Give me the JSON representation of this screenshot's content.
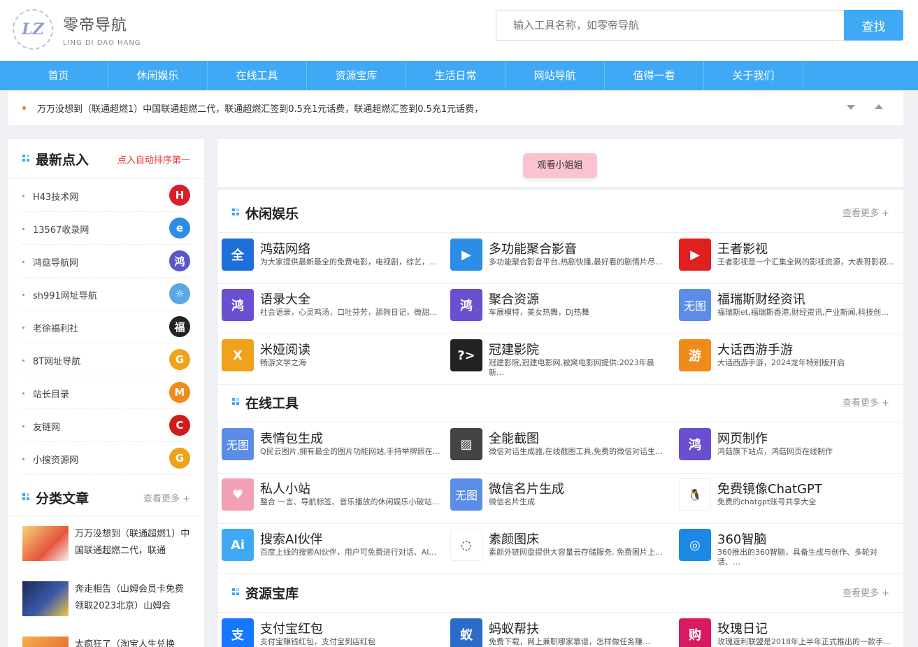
{
  "brand": {
    "name_cn": "零帝导航",
    "name_en": "LING DI DAO HANG",
    "mark": "LZ"
  },
  "search": {
    "placeholder": "输入工具名称，如零帝导航",
    "button": "查找"
  },
  "nav": [
    "首页",
    "休闲娱乐",
    "在线工具",
    "资源宝库",
    "生活日常",
    "网站导航",
    "值得一看",
    "关于我们"
  ],
  "ticker": {
    "text": "万万没想到（联通超燃1）中国联通超燃二代，联通超燃汇签到0.5充1元话费，联通超燃汇签到0.5充1元话费，"
  },
  "colors": {
    "accent": "#3fa9f5",
    "highlight": "#e23b3b",
    "dot": "#f57a18"
  },
  "sidebar": {
    "latest": {
      "title": "最新点入",
      "subtitle": "点入自动排序第一",
      "items": [
        {
          "name": "H43技术网",
          "icon": "H",
          "color": "#d8202a"
        },
        {
          "name": "13567收录网",
          "icon": "e",
          "color": "#2b8de6"
        },
        {
          "name": "鸿菇导航网",
          "icon": "鸿",
          "color": "#5a56c9"
        },
        {
          "name": "sh991网址导航",
          "icon": "☼",
          "color": "#5aa7e6"
        },
        {
          "name": "老徐福利社",
          "icon": "福",
          "color": "#222222"
        },
        {
          "name": "8T网址导航",
          "icon": "G",
          "color": "#f0a21b"
        },
        {
          "name": "站长目录",
          "icon": "M",
          "color": "#f08a1b"
        },
        {
          "name": "友链网",
          "icon": "C",
          "color": "#d21b1b"
        },
        {
          "name": "小搜资源网",
          "icon": "G",
          "color": "#f0a21b"
        }
      ]
    },
    "articles": {
      "title": "分类文章",
      "more": "查看更多 +",
      "items": [
        {
          "title": "万万没想到（联通超燃1）中国联通超燃二代，联通"
        },
        {
          "title": "奔走相告（山姆会员卡免费领取2023北京）山姆会"
        },
        {
          "title": "太疯狂了（淘宝人生兑换"
        }
      ]
    }
  },
  "main": {
    "banner_button": "观看小姐姐",
    "more_label": "查看更多 +",
    "categories": [
      {
        "title": "休闲娱乐",
        "sites": [
          {
            "name": "鸿菇网络",
            "desc": "为大家提供最新最全的免费电影，电视剧，综艺，…",
            "icon": "全",
            "color": "#1e6fd9"
          },
          {
            "name": "多功能聚合影音",
            "desc": "多功能聚合影音平台,热剧快播,最好看的剧情片尽…",
            "icon": "▶",
            "color": "#2b8de6"
          },
          {
            "name": "王者影视",
            "desc": "王者影视是一个汇集全网的影视资源，大表哥影视…",
            "icon": "▶",
            "color": "#e02020"
          },
          {
            "name": "语录大全",
            "desc": "社会语录，心灵鸡汤，口吐芬芳，舔狗日记，微甜…",
            "icon": "鸿",
            "color": "#6a4fd1"
          },
          {
            "name": "聚合资源",
            "desc": "车展模特，美女热舞，DJ热舞",
            "icon": "鸿",
            "color": "#6a4fd1"
          },
          {
            "name": "福瑞斯财经资讯",
            "desc": "福瑞斯et,福瑞斯香港,财经资讯,产业新闻,科技创…",
            "icon": "无图",
            "color": "#5b8de8"
          },
          {
            "name": "米娅阅读",
            "desc": "畅游文学之海",
            "icon": "X",
            "color": "#f0a21b"
          },
          {
            "name": "冠建影院",
            "desc": "冠建影院,冠建电影网,被窝电影网提供:2023年最新…",
            "icon": "?>",
            "color": "#222222"
          },
          {
            "name": "大话西游手游",
            "desc": "大话西游手游，2024龙年特别版开启",
            "icon": "游",
            "color": "#f08a1b"
          }
        ]
      },
      {
        "title": "在线工具",
        "sites": [
          {
            "name": "表情包生成",
            "desc": "Q民云图片,拥有最全的图片功能网站,手持举牌照在…",
            "icon": "无图",
            "color": "#5b8de8"
          },
          {
            "name": "全能截图",
            "desc": "微信对话生成器,在线截图工具,免费的微信对话生…",
            "icon": "▨",
            "color": "#444444"
          },
          {
            "name": "网页制作",
            "desc": "鸿菇旗下站点，鸿菇网页在线制作",
            "icon": "鸿",
            "color": "#6a4fd1"
          },
          {
            "name": "私人小站",
            "desc": "整合 一言、导航标签、音乐播放的休闲娱乐小破站…",
            "icon": "♥",
            "color": "#f2a0b3"
          },
          {
            "name": "微信名片生成",
            "desc": "微信名片生成",
            "icon": "无图",
            "color": "#5b8de8"
          },
          {
            "name": "免费镜像ChatGPT",
            "desc": "免费的chatgpt账号共享大全",
            "icon": "🐧",
            "color": "#ffffff"
          },
          {
            "name": "搜索AI伙伴",
            "desc": "百度上线的搜索AI伙伴，用户可免费进行对话、AI…",
            "icon": "Ai",
            "color": "#3fa9f5"
          },
          {
            "name": "素颜图床",
            "desc": "素颜外链网盘提供大容量云存储服务, 免费图片上…",
            "icon": "◌",
            "color": "#ffffff"
          },
          {
            "name": "360智脑",
            "desc": "360推出的360智脑，具备生成与创作、多轮对话、…",
            "icon": "◎",
            "color": "#1e88e5"
          }
        ]
      },
      {
        "title": "资源宝库",
        "sites": [
          {
            "name": "支付宝红包",
            "desc": "支付宝赚钱红包，支付宝到店红包",
            "icon": "支",
            "color": "#1677ff"
          },
          {
            "name": "蚂蚁帮扶",
            "desc": "免费下载，网上兼职哪家靠谱，怎样做任务赚…",
            "icon": "蚁",
            "color": "#2b6cc9"
          },
          {
            "name": "玫瑰日记",
            "desc": "玫瑰返利联盟是2018年上半年正式推出的一款手…",
            "icon": "购",
            "color": "#d81b60"
          }
        ]
      }
    ]
  }
}
